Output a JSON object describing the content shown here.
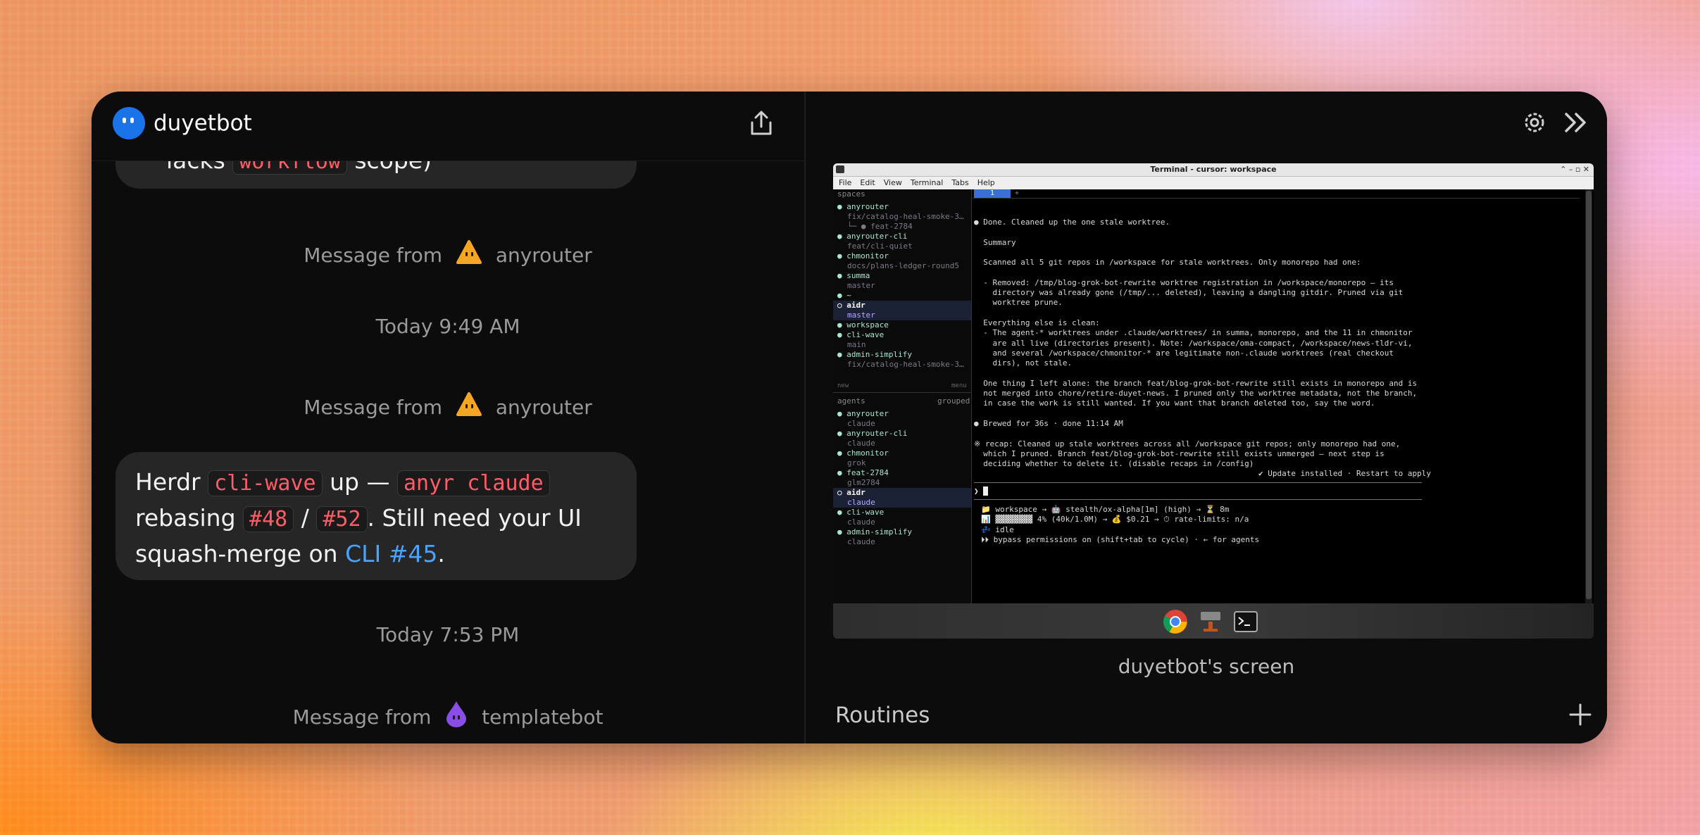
{
  "app": {
    "bot_name": "duyetbot"
  },
  "chat": {
    "top_fragment_pre": "lacks ",
    "top_fragment_code": "workflow",
    "top_fragment_post": " scope)",
    "events": [
      {
        "prefix": "Message from",
        "sender": "anyrouter"
      },
      {
        "time": "Today 9:49 AM"
      },
      {
        "prefix": "Message from",
        "sender": "anyrouter"
      },
      {
        "time": "Today 7:53 PM"
      },
      {
        "prefix": "Message from",
        "sender": "templatebot"
      }
    ],
    "bubble": {
      "t1": "Herdr ",
      "c1": "cli-wave",
      "t2": " up — ",
      "c2": "anyr claude",
      "t3": "rebasing ",
      "c3": "#48",
      "t4": " / ",
      "c4": "#52",
      "t5": ". Still need your UI",
      "t6": "squash-merge on ",
      "link": "CLI #45",
      "t7": "."
    }
  },
  "screen": {
    "window_title": "Terminal - cursor: workspace",
    "menu": [
      "File",
      "Edit",
      "View",
      "Terminal",
      "Tabs",
      "Help"
    ],
    "tab_active": "1",
    "tab_add": "+",
    "spaces_header": "spaces",
    "spaces": [
      {
        "name": "anyrouter",
        "sub": "fix/catalog-heal-smoke-3…"
      },
      {
        "name": "",
        "sub": "└─ ● feat-2784"
      },
      {
        "name": "anyrouter-cli",
        "sub": "feat/cli-quiet"
      },
      {
        "name": "chmonitor",
        "sub": "docs/plans-ledger-round5"
      },
      {
        "name": "summa",
        "sub": "master"
      },
      {
        "name": "~",
        "sub": ""
      },
      {
        "name": "aidr",
        "sub": "master"
      },
      {
        "name": "workspace",
        "sub": ""
      },
      {
        "name": "cli-wave",
        "sub": "main"
      },
      {
        "name": "admin-simplify",
        "sub": "fix/catalog-heal-smoke-3…"
      }
    ],
    "spaces_footer_left": "new",
    "spaces_footer_right": "menu",
    "agents_header": "agents",
    "agents_header_right": "grouped",
    "agents": [
      {
        "name": "anyrouter",
        "sub": "claude"
      },
      {
        "name": "anyrouter-cli",
        "sub": "claude"
      },
      {
        "name": "chmonitor",
        "sub": "grok"
      },
      {
        "name": "feat-2784",
        "sub": "glm2784"
      },
      {
        "name": "aidr",
        "sub": "claude"
      },
      {
        "name": "cli-wave",
        "sub": "claude"
      },
      {
        "name": "admin-simplify",
        "sub": "claude"
      }
    ],
    "terminal_lines": [
      "● Done. Cleaned up the one stale worktree.",
      "",
      "  Summary",
      "",
      "  Scanned all 5 git repos in /workspace for stale worktrees. Only monorepo had one:",
      "",
      "  - Removed: /tmp/blog-grok-bot-rewrite worktree registration in /workspace/monorepo — its",
      "    directory was already gone (/tmp/... deleted), leaving a dangling gitdir. Pruned via git",
      "    worktree prune.",
      "",
      "  Everything else is clean:",
      "  - The agent-* worktrees under .claude/worktrees/ in summa, monorepo, and the 11 in chmonitor",
      "    are all live (directories present). Note: /workspace/oma-compact, /workspace/news-tldr-vi,",
      "    and several /workspace/chmonitor-* are legitimate non-.claude worktrees (real checkout",
      "    dirs), not stale.",
      "",
      "  One thing I left alone: the branch feat/blog-grok-bot-rewrite still exists in monorepo and is",
      "  not merged into chore/retire-duyet-news. I pruned only the worktree metadata, not the branch,",
      "  in case the work is still wanted. If you want that branch deleted too, say the word.",
      "",
      "● Brewed for 36s · done 11:14 AM",
      "",
      "※ recap: Cleaned up stale worktrees across all /workspace git repos; only monorepo had one,",
      "  which I pruned. Branch feat/blog-grok-bot-rewrite still exists unmerged — next step is",
      "  deciding whether to delete it. (disable recaps in /config)",
      "                                                             ✔ Update installed · Restart to apply"
    ],
    "prompt": "❯ ",
    "status_lines": [
      "📁 workspace → 🤖 stealth/ox-alpha[1m] (high) → ⏳ 8m",
      "📊 ▓▓▓▓▓▓▓▓ 4% (40k/1.0M) → 💰 $0.21 → ⏱ rate-limits: n/a",
      "💤 idle",
      "⏵⏵ bypass permissions on (shift+tab to cycle) · ← for agents"
    ],
    "caption": "duyetbot's screen"
  },
  "routines": {
    "title": "Routines"
  },
  "colors": {
    "accent_blue": "#1a73e8",
    "code_red": "#ff5c68",
    "link_blue": "#4aa3ff",
    "anyrouter_orange": "#f5a623",
    "templatebot_purple": "#8a4de8"
  }
}
